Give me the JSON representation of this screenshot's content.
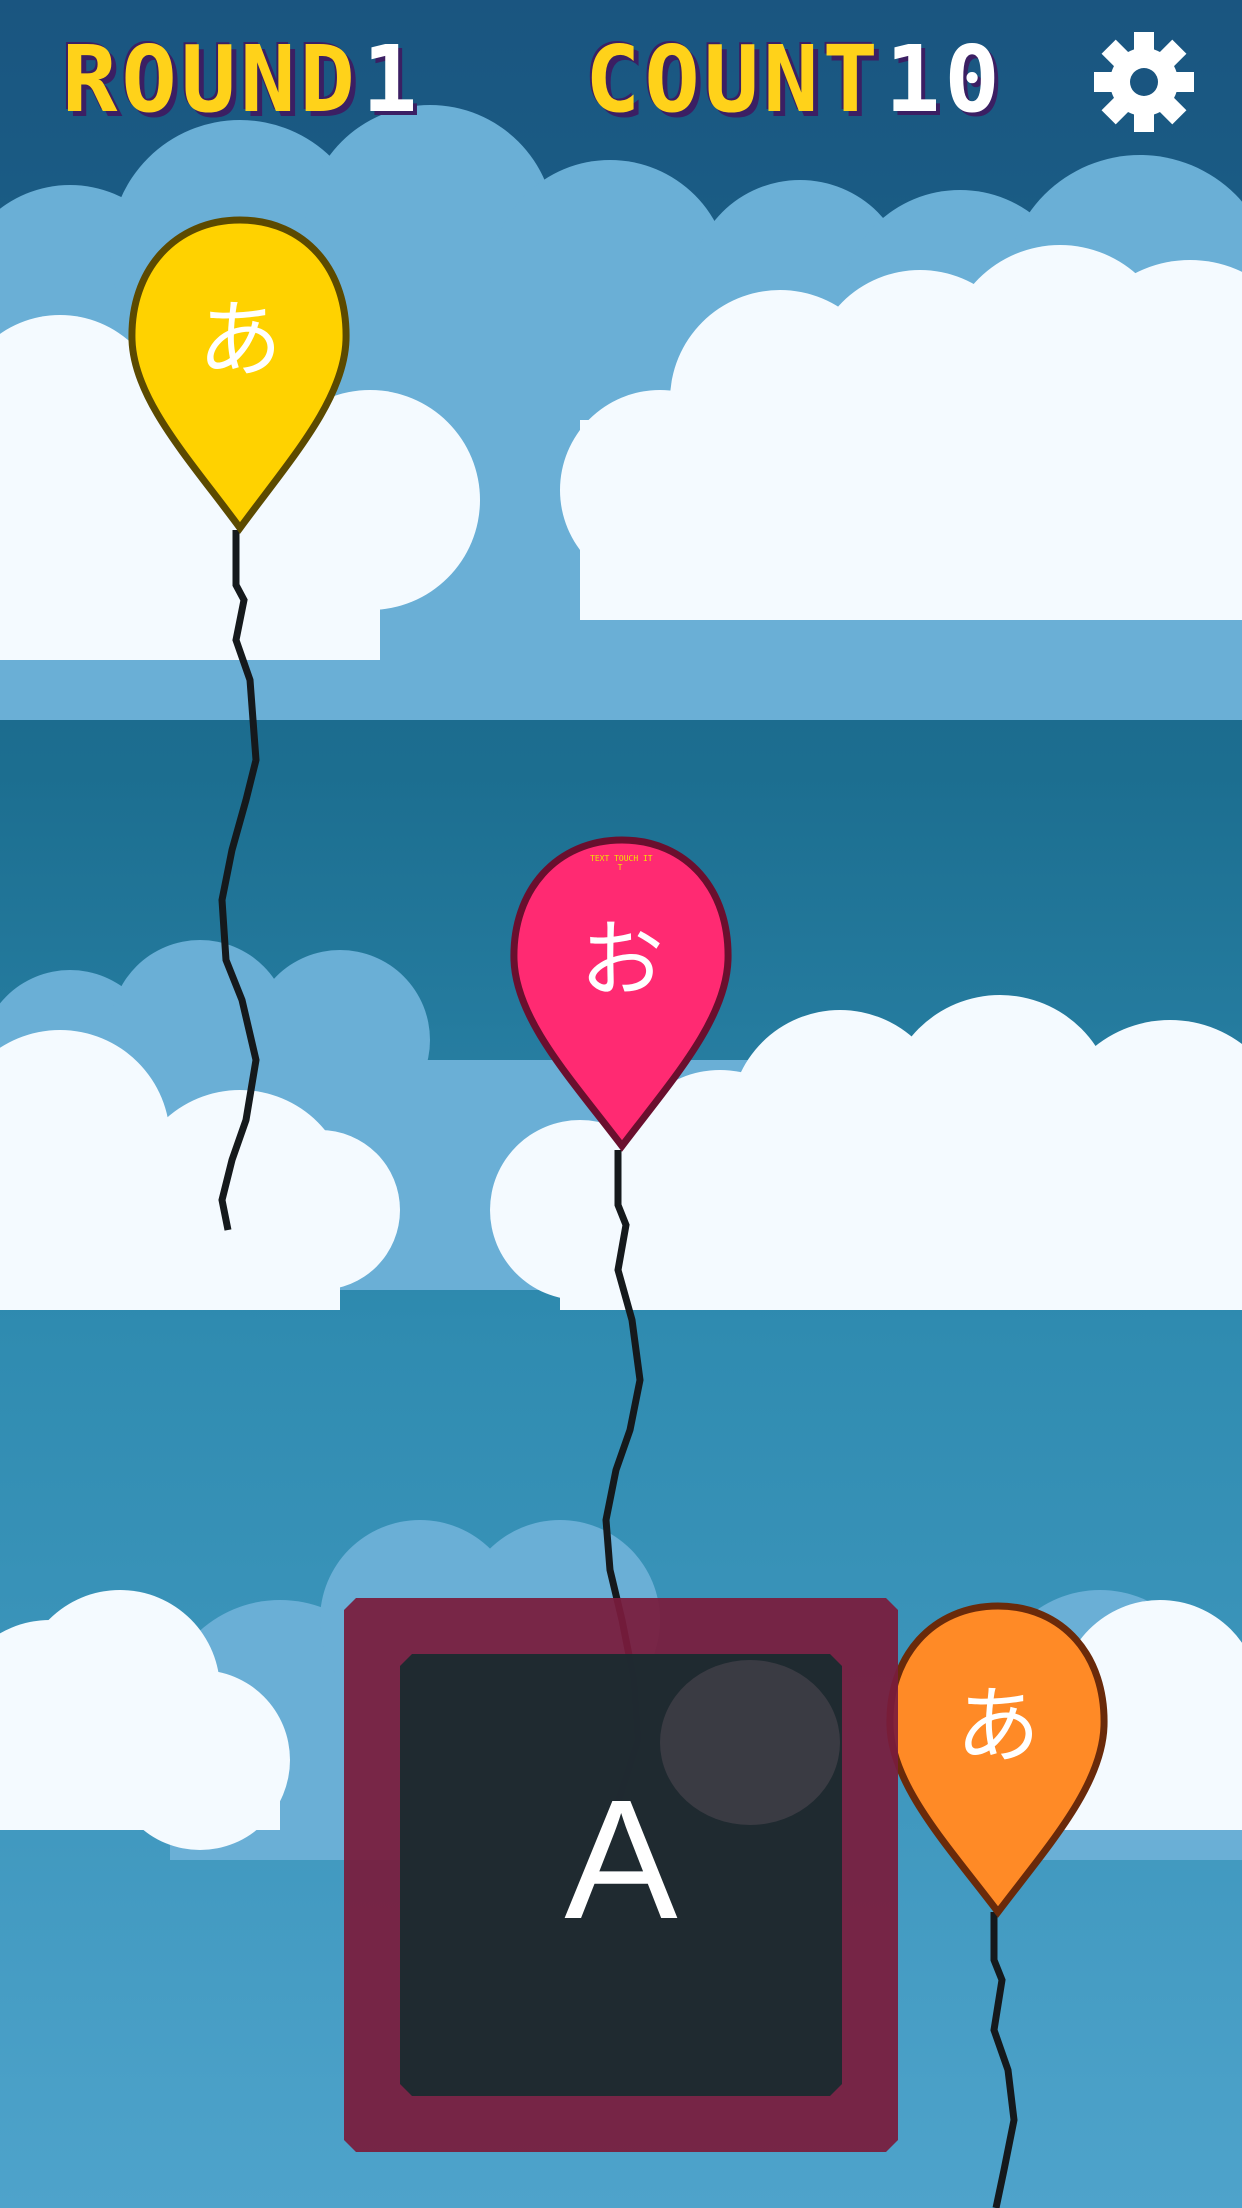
{
  "hud": {
    "round_label": "ROUND",
    "round_value": "1",
    "count_label": "COUNT",
    "count_value": "10",
    "settings_icon": "gear-icon"
  },
  "balloons": [
    {
      "char": "あ",
      "color": "#ffd200",
      "outline": "#5c4a00"
    },
    {
      "char": "お",
      "color": "#ff2a72",
      "outline": "#6a0f2e",
      "tiny_text": "TEXT TOUCH IT\nT"
    },
    {
      "char": "あ",
      "color": "#ff8a26",
      "outline": "#6a2a0a"
    }
  ],
  "answer": {
    "letter": "A"
  },
  "colors": {
    "sky_top": "#1a5f87",
    "sky_bottom": "#4aa0c8",
    "hud_text": "#ffd21a",
    "hud_shadow": "#3b1f63",
    "answer_frame": "#7a1c3c",
    "answer_inner": "#1c2a30"
  }
}
